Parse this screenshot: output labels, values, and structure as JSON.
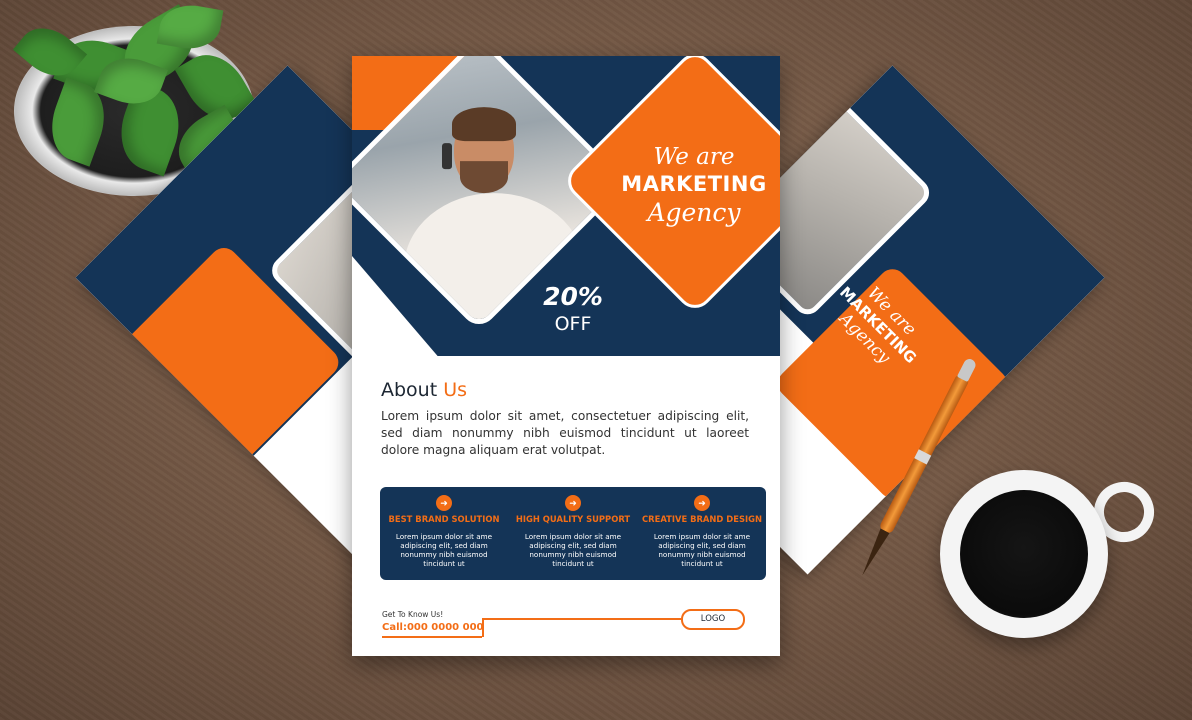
{
  "flyer": {
    "headline": {
      "line1": "We are",
      "line2": "MARKETING",
      "line3": "Agency"
    },
    "discount": {
      "percent": "20%",
      "label": "OFF"
    },
    "about": {
      "title_main": "About",
      "title_accent": "Us",
      "body": "Lorem ipsum dolor sit amet, consectetuer adipiscing elit, sed diam nonummy nibh euismod tincidunt ut laoreet dolore magna aliquam erat volutpat."
    },
    "features": [
      {
        "title": "BEST BRAND SOLUTION",
        "text": "Lorem ipsum dolor sit ame adipiscing elit, sed diam nonummy nibh euismod tincidunt ut",
        "icon": "arrow-right-icon"
      },
      {
        "title": "HIGH QUALITY SUPPORT",
        "text": "Lorem ipsum dolor sit ame adipiscing elit, sed diam nonummy nibh euismod tincidunt ut",
        "icon": "arrow-right-icon"
      },
      {
        "title": "CREATIVE BRAND DESIGN",
        "text": "Lorem ipsum dolor sit ame adipiscing elit, sed diam nonummy nibh euismod tincidunt ut",
        "icon": "arrow-right-icon"
      }
    ],
    "footer": {
      "kicker": "Get To Know Us!",
      "phone": "Call:000 0000 000",
      "logo_label": "LOGO"
    }
  },
  "back_flyer": {
    "headline_line1": "We are",
    "headline_line2": "MARKETING",
    "headline_line3": "Agency"
  },
  "colors": {
    "orange": "#f36d16",
    "navy": "#143457",
    "white": "#ffffff",
    "table_wood": "#7a5c48"
  }
}
